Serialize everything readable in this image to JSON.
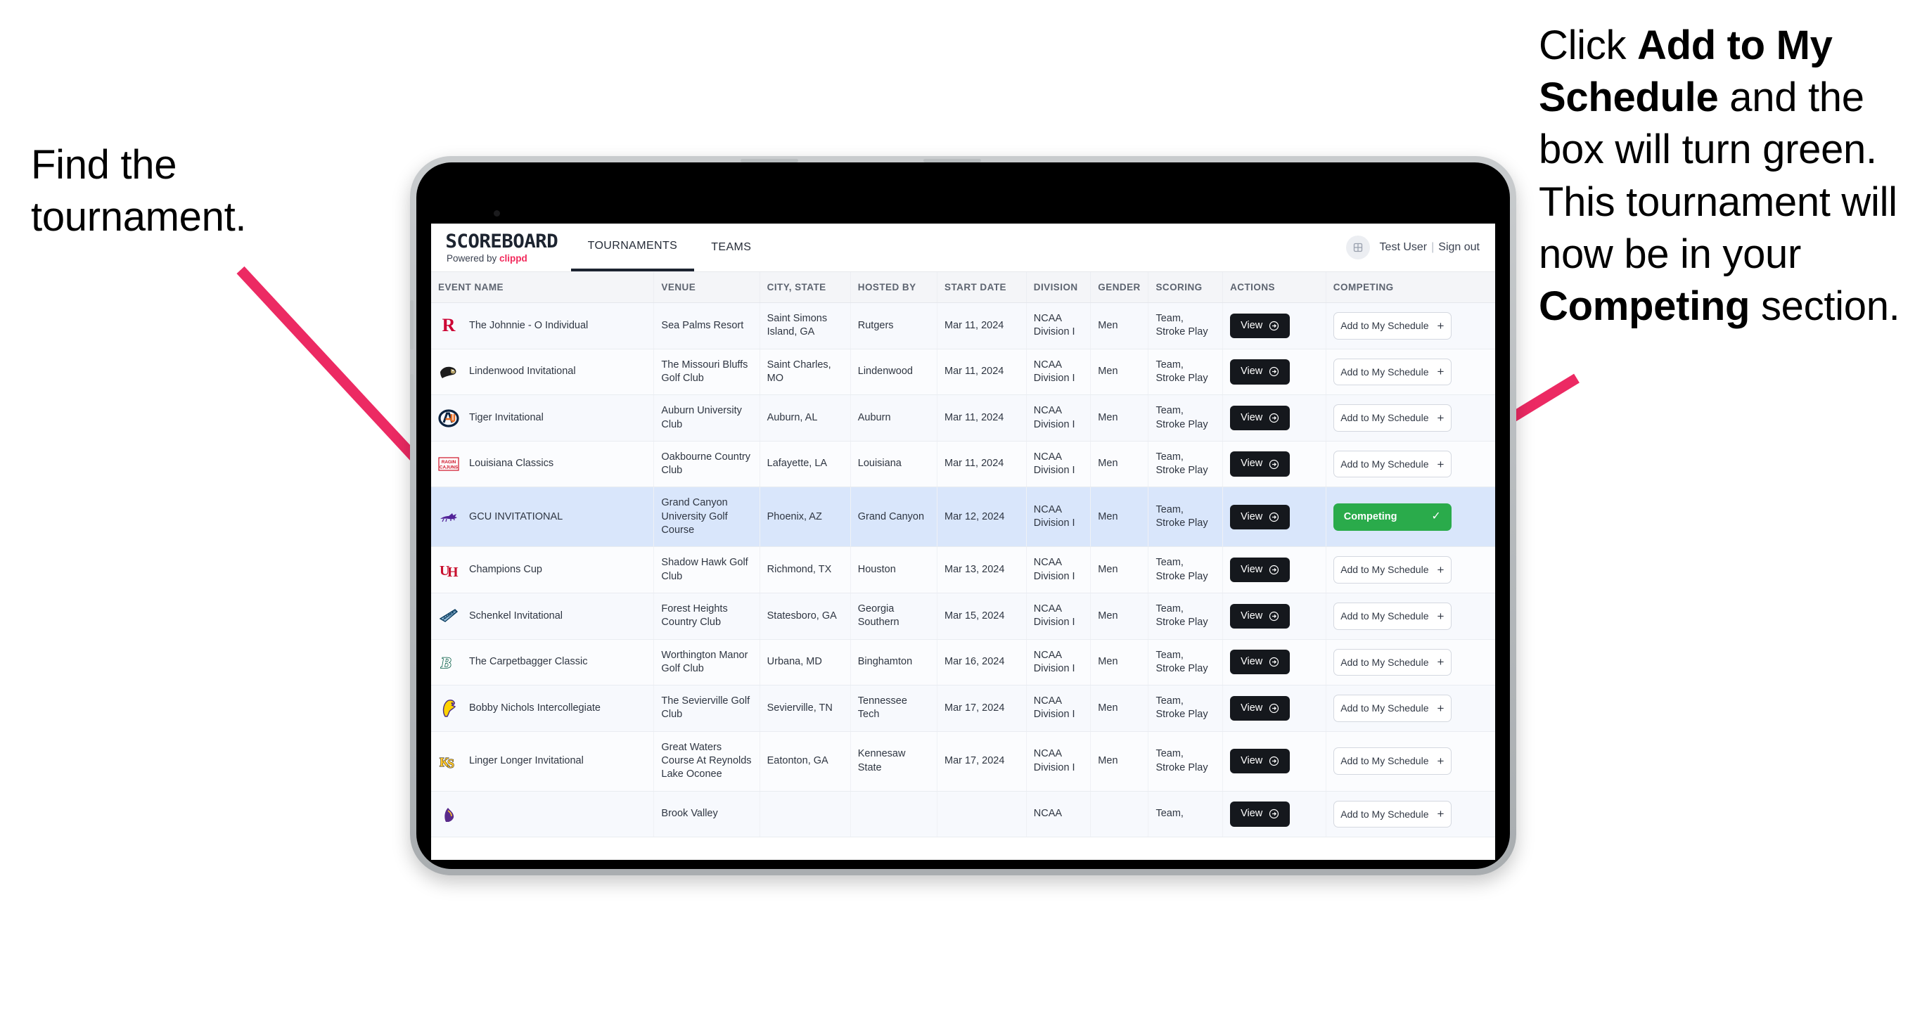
{
  "annotations": {
    "left": {
      "lines": [
        "Find the",
        "tournament."
      ]
    },
    "right": {
      "segments": [
        {
          "text": "Click ",
          "bold": false
        },
        {
          "text": "Add to My Schedule",
          "bold": true
        },
        {
          "text": " and the box will turn green. This tournament will now be in your ",
          "bold": false
        },
        {
          "text": "Competing",
          "bold": true
        },
        {
          "text": " section.",
          "bold": false
        }
      ]
    },
    "arrow_color": "#ec2a63"
  },
  "app": {
    "brand": {
      "title": "SCOREBOARD",
      "powered_prefix": "Powered by ",
      "powered_brand": "clippd",
      "brand_color": "#f2295b"
    },
    "nav": [
      {
        "label": "TOURNAMENTS",
        "active": true
      },
      {
        "label": "TEAMS",
        "active": false
      }
    ],
    "user": {
      "avatar_icon": "user-avatar-icon",
      "name": "Test User",
      "separator": "|",
      "signout": "Sign out"
    },
    "table": {
      "columns": [
        "EVENT NAME",
        "VENUE",
        "CITY, STATE",
        "HOSTED BY",
        "START DATE",
        "DIVISION",
        "GENDER",
        "SCORING",
        "ACTIONS",
        "COMPETING"
      ],
      "view_label": "View",
      "add_label": "Add to My Schedule",
      "competing_label": "Competing",
      "competing_color": "#2aab4b",
      "rows": [
        {
          "logo": "rutgers-logo",
          "event": "The Johnnie - O Individual",
          "venue": "Sea Palms Resort",
          "city": "Saint Simons Island, GA",
          "host": "Rutgers",
          "date": "Mar 11, 2024",
          "division": "NCAA Division I",
          "gender": "Men",
          "scoring": "Team, Stroke Play",
          "competing": false,
          "selected": false
        },
        {
          "logo": "lindenwood-logo",
          "event": "Lindenwood Invitational",
          "venue": "The Missouri Bluffs Golf Club",
          "city": "Saint Charles, MO",
          "host": "Lindenwood",
          "date": "Mar 11, 2024",
          "division": "NCAA Division I",
          "gender": "Men",
          "scoring": "Team, Stroke Play",
          "competing": false,
          "selected": false
        },
        {
          "logo": "auburn-logo",
          "event": "Tiger Invitational",
          "venue": "Auburn University Club",
          "city": "Auburn, AL",
          "host": "Auburn",
          "date": "Mar 11, 2024",
          "division": "NCAA Division I",
          "gender": "Men",
          "scoring": "Team, Stroke Play",
          "competing": false,
          "selected": false
        },
        {
          "logo": "louisiana-logo",
          "event": "Louisiana Classics",
          "venue": "Oakbourne Country Club",
          "city": "Lafayette, LA",
          "host": "Louisiana",
          "date": "Mar 11, 2024",
          "division": "NCAA Division I",
          "gender": "Men",
          "scoring": "Team, Stroke Play",
          "competing": false,
          "selected": false
        },
        {
          "logo": "gcu-logo",
          "event": "GCU INVITATIONAL",
          "venue": "Grand Canyon University Golf Course",
          "city": "Phoenix, AZ",
          "host": "Grand Canyon",
          "date": "Mar 12, 2024",
          "division": "NCAA Division I",
          "gender": "Men",
          "scoring": "Team, Stroke Play",
          "competing": true,
          "selected": true
        },
        {
          "logo": "houston-logo",
          "event": "Champions Cup",
          "venue": "Shadow Hawk Golf Club",
          "city": "Richmond, TX",
          "host": "Houston",
          "date": "Mar 13, 2024",
          "division": "NCAA Division I",
          "gender": "Men",
          "scoring": "Team, Stroke Play",
          "competing": false,
          "selected": false
        },
        {
          "logo": "georgia-southern-logo",
          "event": "Schenkel Invitational",
          "venue": "Forest Heights Country Club",
          "city": "Statesboro, GA",
          "host": "Georgia Southern",
          "date": "Mar 15, 2024",
          "division": "NCAA Division I",
          "gender": "Men",
          "scoring": "Team, Stroke Play",
          "competing": false,
          "selected": false
        },
        {
          "logo": "binghamton-logo",
          "event": "The Carpetbagger Classic",
          "venue": "Worthington Manor Golf Club",
          "city": "Urbana, MD",
          "host": "Binghamton",
          "date": "Mar 16, 2024",
          "division": "NCAA Division I",
          "gender": "Men",
          "scoring": "Team, Stroke Play",
          "competing": false,
          "selected": false
        },
        {
          "logo": "tennessee-tech-logo",
          "event": "Bobby Nichols Intercollegiate",
          "venue": "The Sevierville Golf Club",
          "city": "Sevierville, TN",
          "host": "Tennessee Tech",
          "date": "Mar 17, 2024",
          "division": "NCAA Division I",
          "gender": "Men",
          "scoring": "Team, Stroke Play",
          "competing": false,
          "selected": false
        },
        {
          "logo": "kennesaw-logo",
          "event": "Linger Longer Invitational",
          "venue": "Great Waters Course At Reynolds Lake Oconee",
          "city": "Eatonton, GA",
          "host": "Kennesaw State",
          "date": "Mar 17, 2024",
          "division": "NCAA Division I",
          "gender": "Men",
          "scoring": "Team, Stroke Play",
          "competing": false,
          "selected": false
        },
        {
          "logo": "east-carolina-logo",
          "event": "",
          "venue": "Brook Valley",
          "city": "",
          "host": "",
          "date": "",
          "division": "NCAA",
          "gender": "",
          "scoring": "Team,",
          "competing": false,
          "selected": false
        }
      ]
    }
  }
}
